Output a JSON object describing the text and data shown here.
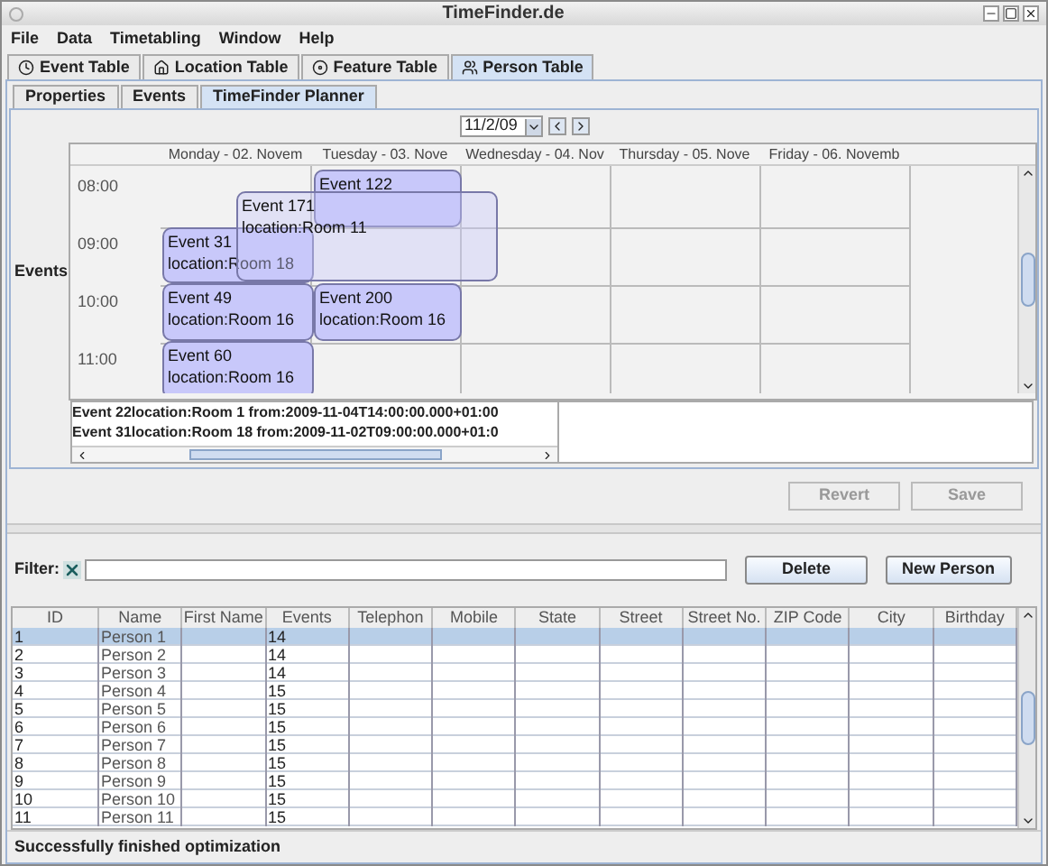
{
  "window": {
    "title": "TimeFinder.de"
  },
  "menu": [
    "File",
    "Data",
    "Timetabling",
    "Window",
    "Help"
  ],
  "tabs": [
    {
      "label": "Event Table",
      "selected": false
    },
    {
      "label": "Location Table",
      "selected": false
    },
    {
      "label": "Feature Table",
      "selected": false
    },
    {
      "label": "Person Table",
      "selected": true
    }
  ],
  "subtabs": [
    {
      "label": "Properties",
      "selected": false
    },
    {
      "label": "Events",
      "selected": false
    },
    {
      "label": "TimeFinder Planner",
      "selected": true
    }
  ],
  "planner": {
    "date": "11/2/09",
    "side_label": "Events",
    "days": [
      "Monday - 02. Novem",
      "Tuesday - 03. Nove",
      "Wednesday - 04. Nov",
      "Thursday - 05. Nove",
      "Friday - 06. Novemb"
    ],
    "times": [
      "08:00",
      "09:00",
      "10:00",
      "11:00"
    ],
    "events": [
      {
        "title": "Event 122"
      },
      {
        "title": "Event 171",
        "location": "location:Room 11"
      },
      {
        "title": "Event 31",
        "location": "location:Room 18"
      },
      {
        "title": "Event 49",
        "location": "location:Room 16"
      },
      {
        "title": "Event 200",
        "location": "location:Room 16"
      },
      {
        "title": "Event 60",
        "location": "location:Room 16"
      }
    ],
    "log": [
      "Event 22location:Room 1 from:2009-11-04T14:00:00.000+01:00",
      "Event 31location:Room 18 from:2009-11-02T09:00:00.000+01:0"
    ]
  },
  "actions": [
    {
      "label": "Revert",
      "disabled": true
    },
    {
      "label": "Save",
      "disabled": true
    }
  ],
  "filter": {
    "label": "Filter:"
  },
  "buttons": [
    "Delete",
    "New Person"
  ],
  "table": {
    "columns": [
      "ID",
      "Name",
      "First Name",
      "Events",
      "Telephon",
      "Mobile",
      "State",
      "Street",
      "Street No.",
      "ZIP Code",
      "City",
      "Birthday"
    ],
    "rows": [
      {
        "id": "1",
        "name": "Person 1",
        "events": "14",
        "selected": true
      },
      {
        "id": "2",
        "name": "Person 2",
        "events": "14",
        "selected": false
      },
      {
        "id": "3",
        "name": "Person 3",
        "events": "14",
        "selected": false
      },
      {
        "id": "4",
        "name": "Person 4",
        "events": "15",
        "selected": false
      },
      {
        "id": "5",
        "name": "Person 5",
        "events": "15",
        "selected": false
      },
      {
        "id": "6",
        "name": "Person 6",
        "events": "15",
        "selected": false
      },
      {
        "id": "7",
        "name": "Person 7",
        "events": "15",
        "selected": false
      },
      {
        "id": "8",
        "name": "Person 8",
        "events": "15",
        "selected": false
      },
      {
        "id": "9",
        "name": "Person 9",
        "events": "15",
        "selected": false
      },
      {
        "id": "10",
        "name": "Person 10",
        "events": "15",
        "selected": false
      },
      {
        "id": "11",
        "name": "Person 11",
        "events": "15",
        "selected": false
      }
    ]
  },
  "status_bar": "Successfully finished optimization"
}
